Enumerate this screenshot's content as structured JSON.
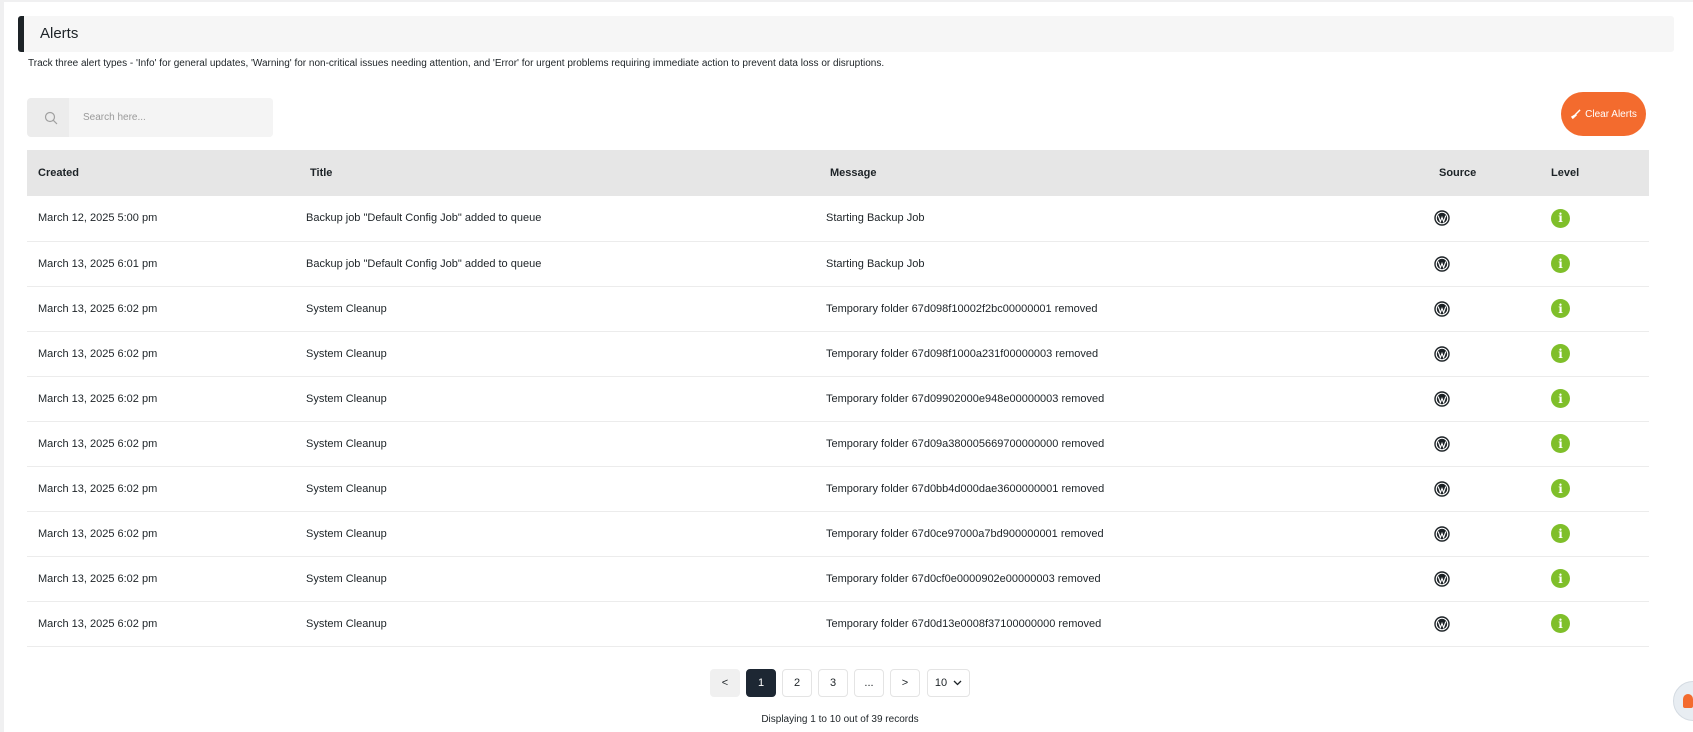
{
  "header": {
    "title": "Alerts"
  },
  "description": "Track three alert types - 'Info' for general updates, 'Warning' for non-critical issues needing attention, and 'Error' for urgent problems requiring immediate action to prevent data loss or disruptions.",
  "search": {
    "placeholder": "Search here..."
  },
  "clear_button": {
    "label": "Clear Alerts"
  },
  "table": {
    "headers": {
      "created": "Created",
      "title": "Title",
      "message": "Message",
      "source": "Source",
      "level": "Level"
    },
    "rows": [
      {
        "created": "March 12, 2025 5:00 pm",
        "title": "Backup job \"Default Config Job\" added to queue",
        "message": "Starting Backup Job",
        "source_icon": "wordpress-icon",
        "level": "info"
      },
      {
        "created": "March 13, 2025 6:01 pm",
        "title": "Backup job \"Default Config Job\" added to queue",
        "message": "Starting Backup Job",
        "source_icon": "wordpress-icon",
        "level": "info"
      },
      {
        "created": "March 13, 2025 6:02 pm",
        "title": "System Cleanup",
        "message": "Temporary folder 67d098f10002f2bc00000001 removed",
        "source_icon": "wordpress-icon",
        "level": "info"
      },
      {
        "created": "March 13, 2025 6:02 pm",
        "title": "System Cleanup",
        "message": "Temporary folder 67d098f1000a231f00000003 removed",
        "source_icon": "wordpress-icon",
        "level": "info"
      },
      {
        "created": "March 13, 2025 6:02 pm",
        "title": "System Cleanup",
        "message": "Temporary folder 67d09902000e948e00000003 removed",
        "source_icon": "wordpress-icon",
        "level": "info"
      },
      {
        "created": "March 13, 2025 6:02 pm",
        "title": "System Cleanup",
        "message": "Temporary folder 67d09a380005669700000000 removed",
        "source_icon": "wordpress-icon",
        "level": "info"
      },
      {
        "created": "March 13, 2025 6:02 pm",
        "title": "System Cleanup",
        "message": "Temporary folder 67d0bb4d000dae3600000001 removed",
        "source_icon": "wordpress-icon",
        "level": "info"
      },
      {
        "created": "March 13, 2025 6:02 pm",
        "title": "System Cleanup",
        "message": "Temporary folder 67d0ce97000a7bd900000001 removed",
        "source_icon": "wordpress-icon",
        "level": "info"
      },
      {
        "created": "March 13, 2025 6:02 pm",
        "title": "System Cleanup",
        "message": "Temporary folder 67d0cf0e0000902e00000003 removed",
        "source_icon": "wordpress-icon",
        "level": "info"
      },
      {
        "created": "March 13, 2025 6:02 pm",
        "title": "System Cleanup",
        "message": "Temporary folder 67d0d13e0008f37100000000 removed",
        "source_icon": "wordpress-icon",
        "level": "info"
      }
    ]
  },
  "pagination": {
    "prev": "<",
    "pages": [
      "1",
      "2",
      "3",
      "..."
    ],
    "current": "1",
    "next": ">",
    "per_page": "10",
    "summary": "Displaying 1 to 10 out of 39 records"
  },
  "colors": {
    "accent": "#f36b2e",
    "info": "#7fbf2a",
    "active_page": "#1d2733"
  }
}
